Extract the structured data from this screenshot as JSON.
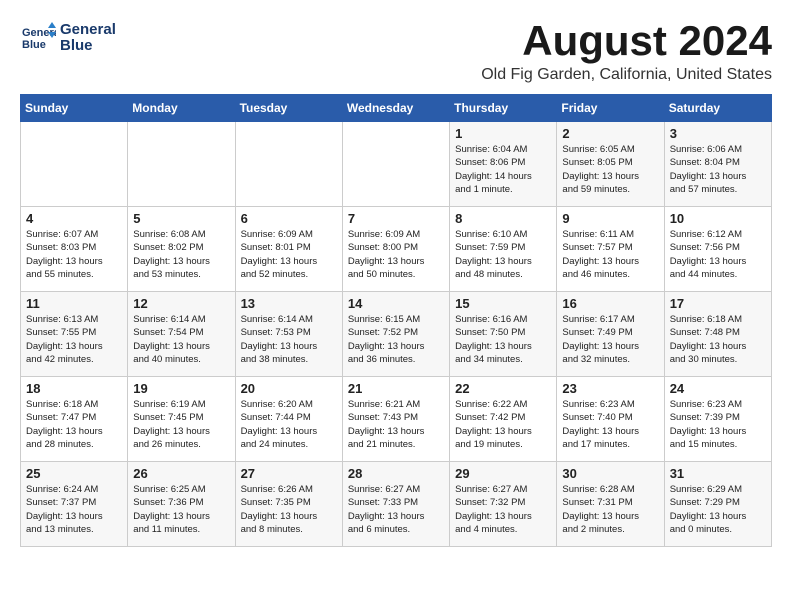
{
  "header": {
    "logo_line1": "General",
    "logo_line2": "Blue",
    "month": "August 2024",
    "location": "Old Fig Garden, California, United States"
  },
  "days_of_week": [
    "Sunday",
    "Monday",
    "Tuesday",
    "Wednesday",
    "Thursday",
    "Friday",
    "Saturday"
  ],
  "weeks": [
    [
      {
        "day": "",
        "info": ""
      },
      {
        "day": "",
        "info": ""
      },
      {
        "day": "",
        "info": ""
      },
      {
        "day": "",
        "info": ""
      },
      {
        "day": "1",
        "info": "Sunrise: 6:04 AM\nSunset: 8:06 PM\nDaylight: 14 hours\nand 1 minute."
      },
      {
        "day": "2",
        "info": "Sunrise: 6:05 AM\nSunset: 8:05 PM\nDaylight: 13 hours\nand 59 minutes."
      },
      {
        "day": "3",
        "info": "Sunrise: 6:06 AM\nSunset: 8:04 PM\nDaylight: 13 hours\nand 57 minutes."
      }
    ],
    [
      {
        "day": "4",
        "info": "Sunrise: 6:07 AM\nSunset: 8:03 PM\nDaylight: 13 hours\nand 55 minutes."
      },
      {
        "day": "5",
        "info": "Sunrise: 6:08 AM\nSunset: 8:02 PM\nDaylight: 13 hours\nand 53 minutes."
      },
      {
        "day": "6",
        "info": "Sunrise: 6:09 AM\nSunset: 8:01 PM\nDaylight: 13 hours\nand 52 minutes."
      },
      {
        "day": "7",
        "info": "Sunrise: 6:09 AM\nSunset: 8:00 PM\nDaylight: 13 hours\nand 50 minutes."
      },
      {
        "day": "8",
        "info": "Sunrise: 6:10 AM\nSunset: 7:59 PM\nDaylight: 13 hours\nand 48 minutes."
      },
      {
        "day": "9",
        "info": "Sunrise: 6:11 AM\nSunset: 7:57 PM\nDaylight: 13 hours\nand 46 minutes."
      },
      {
        "day": "10",
        "info": "Sunrise: 6:12 AM\nSunset: 7:56 PM\nDaylight: 13 hours\nand 44 minutes."
      }
    ],
    [
      {
        "day": "11",
        "info": "Sunrise: 6:13 AM\nSunset: 7:55 PM\nDaylight: 13 hours\nand 42 minutes."
      },
      {
        "day": "12",
        "info": "Sunrise: 6:14 AM\nSunset: 7:54 PM\nDaylight: 13 hours\nand 40 minutes."
      },
      {
        "day": "13",
        "info": "Sunrise: 6:14 AM\nSunset: 7:53 PM\nDaylight: 13 hours\nand 38 minutes."
      },
      {
        "day": "14",
        "info": "Sunrise: 6:15 AM\nSunset: 7:52 PM\nDaylight: 13 hours\nand 36 minutes."
      },
      {
        "day": "15",
        "info": "Sunrise: 6:16 AM\nSunset: 7:50 PM\nDaylight: 13 hours\nand 34 minutes."
      },
      {
        "day": "16",
        "info": "Sunrise: 6:17 AM\nSunset: 7:49 PM\nDaylight: 13 hours\nand 32 minutes."
      },
      {
        "day": "17",
        "info": "Sunrise: 6:18 AM\nSunset: 7:48 PM\nDaylight: 13 hours\nand 30 minutes."
      }
    ],
    [
      {
        "day": "18",
        "info": "Sunrise: 6:18 AM\nSunset: 7:47 PM\nDaylight: 13 hours\nand 28 minutes."
      },
      {
        "day": "19",
        "info": "Sunrise: 6:19 AM\nSunset: 7:45 PM\nDaylight: 13 hours\nand 26 minutes."
      },
      {
        "day": "20",
        "info": "Sunrise: 6:20 AM\nSunset: 7:44 PM\nDaylight: 13 hours\nand 24 minutes."
      },
      {
        "day": "21",
        "info": "Sunrise: 6:21 AM\nSunset: 7:43 PM\nDaylight: 13 hours\nand 21 minutes."
      },
      {
        "day": "22",
        "info": "Sunrise: 6:22 AM\nSunset: 7:42 PM\nDaylight: 13 hours\nand 19 minutes."
      },
      {
        "day": "23",
        "info": "Sunrise: 6:23 AM\nSunset: 7:40 PM\nDaylight: 13 hours\nand 17 minutes."
      },
      {
        "day": "24",
        "info": "Sunrise: 6:23 AM\nSunset: 7:39 PM\nDaylight: 13 hours\nand 15 minutes."
      }
    ],
    [
      {
        "day": "25",
        "info": "Sunrise: 6:24 AM\nSunset: 7:37 PM\nDaylight: 13 hours\nand 13 minutes."
      },
      {
        "day": "26",
        "info": "Sunrise: 6:25 AM\nSunset: 7:36 PM\nDaylight: 13 hours\nand 11 minutes."
      },
      {
        "day": "27",
        "info": "Sunrise: 6:26 AM\nSunset: 7:35 PM\nDaylight: 13 hours\nand 8 minutes."
      },
      {
        "day": "28",
        "info": "Sunrise: 6:27 AM\nSunset: 7:33 PM\nDaylight: 13 hours\nand 6 minutes."
      },
      {
        "day": "29",
        "info": "Sunrise: 6:27 AM\nSunset: 7:32 PM\nDaylight: 13 hours\nand 4 minutes."
      },
      {
        "day": "30",
        "info": "Sunrise: 6:28 AM\nSunset: 7:31 PM\nDaylight: 13 hours\nand 2 minutes."
      },
      {
        "day": "31",
        "info": "Sunrise: 6:29 AM\nSunset: 7:29 PM\nDaylight: 13 hours\nand 0 minutes."
      }
    ]
  ]
}
